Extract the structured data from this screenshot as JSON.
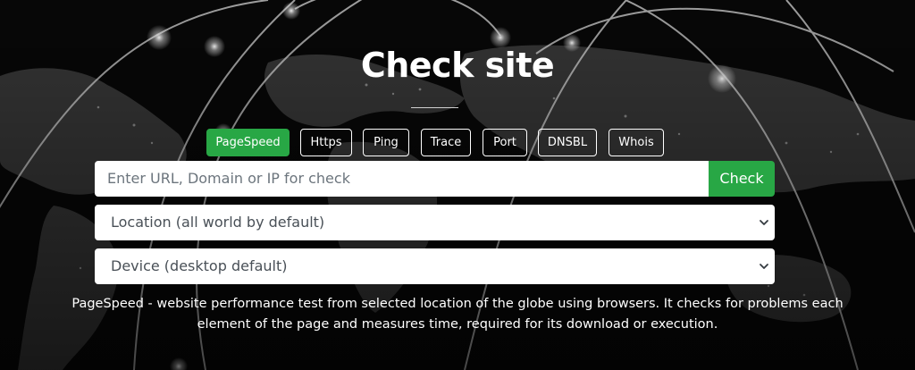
{
  "page": {
    "title": "Check site"
  },
  "tabs": [
    {
      "label": "PageSpeed",
      "active": true
    },
    {
      "label": "Https",
      "active": false
    },
    {
      "label": "Ping",
      "active": false
    },
    {
      "label": "Trace",
      "active": false
    },
    {
      "label": "Port",
      "active": false
    },
    {
      "label": "DNSBL",
      "active": false
    },
    {
      "label": "Whois",
      "active": false
    }
  ],
  "search": {
    "placeholder": "Enter URL, Domain or IP for check",
    "value": "",
    "button_label": "Check"
  },
  "location_select": {
    "selected": "Location (all world by default)"
  },
  "device_select": {
    "selected": "Device (desktop default)"
  },
  "description": "PageSpeed - website performance test from selected location of the globe using browsers. It checks for problems each element of the page and measures time, required for its download or execution.",
  "colors": {
    "accent": "#28a745",
    "background": "#060606",
    "text": "#ffffff",
    "placeholder": "#6c757d"
  },
  "icons": {
    "select_arrow": "chevron-down-icon"
  }
}
